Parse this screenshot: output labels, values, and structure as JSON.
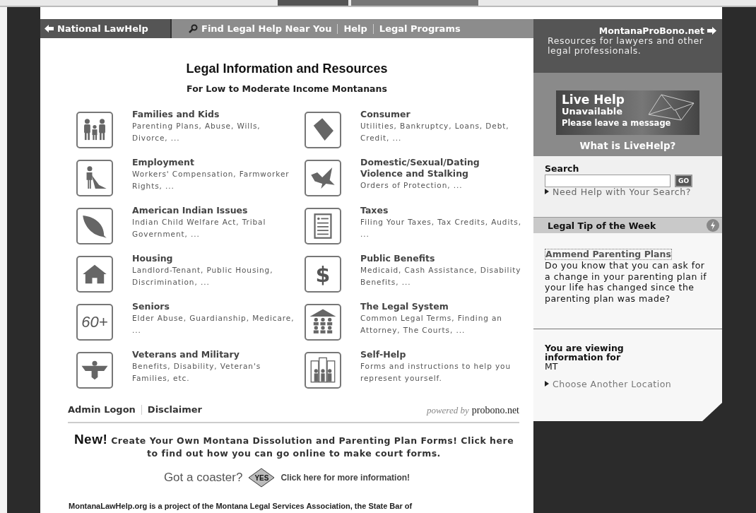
{
  "nav": {
    "home": {
      "label": "National LawHelp"
    },
    "links": [
      {
        "label": "Find Legal Help Near You",
        "kind": "search"
      },
      {
        "label": "Help",
        "kind": "plain"
      },
      {
        "label": "Legal Programs",
        "kind": "plain"
      }
    ]
  },
  "header": {
    "title": "Legal Information and Resources",
    "subtitle": "For Low to Moderate Income Montanans"
  },
  "categories": [
    {
      "title": "Families and Kids",
      "description": "Parenting Plans, Abuse, Wills, Divorce, ..."
    },
    {
      "title": "Consumer",
      "description": "Utilities, Bankruptcy, Loans, Debt, Credit, ..."
    },
    {
      "title": "Employment",
      "description": "Workers' Compensation, Farmworker Rights, ..."
    },
    {
      "title": "Domestic/Sexual/Dating Violence and Stalking",
      "description": "Orders of Protection, ..."
    },
    {
      "title": "American Indian Issues",
      "description": "Indian Child Welfare Act, Tribal Government, ..."
    },
    {
      "title": "Taxes",
      "description": "Filing Your Taxes, Tax Credits, Audits, ..."
    },
    {
      "title": "Housing",
      "description": "Landlord-Tenant, Public Housing, Discrimination, ..."
    },
    {
      "title": "Public Benefits",
      "description": "Medicaid, Cash Assistance, Disability Benefits, ...",
      "icon_text": "$"
    },
    {
      "title": "Seniors",
      "description": "Elder Abuse, Guardianship, Medicare, ...",
      "icon_text": "60+"
    },
    {
      "title": "The Legal System",
      "description": "Common Legal Terms, Finding an Attorney, The Courts, ..."
    },
    {
      "title": "Veterans and Military",
      "description": "Benefits, Disability, Veteran's Families, etc."
    },
    {
      "title": "Self-Help",
      "description": "Forms and instructions to help you represent yourself."
    }
  ],
  "footer_links": [
    "Admin Logon",
    "Disclaimer"
  ],
  "powered_by": {
    "prefix": "powered by",
    "brand": "probono.net"
  },
  "promo": {
    "lead": "New!",
    "text": "Create Your Own Montana Dissolution and Parenting Plan Forms! Click here to find out how you can go online to make court forms."
  },
  "coaster": {
    "question": "Got a coaster?",
    "badge": "YES",
    "link": "Click here for more information!"
  },
  "project_note": "MontanaLawHelp.org is a project of the Montana Legal Services Association, the State Bar of",
  "sidebar": {
    "probono": {
      "title": "MontanaProBono.net",
      "description": "Resources for lawyers and other legal professionals."
    },
    "livehelp": {
      "title": "Live Help",
      "status": "Unavailable",
      "message": "Please leave a message",
      "link": "What is LiveHelp?"
    },
    "search": {
      "label": "Search",
      "button": "GO",
      "help_link": "Need Help with Your Search?"
    },
    "tip": {
      "heading": "Legal Tip of the Week",
      "title": "Ammend Parenting Plans",
      "text": "Do you know that you can ask for a change in your parenting plan if your life has changed since the parenting plan was made?"
    },
    "location": {
      "label": "You are viewing information for",
      "value": "MT",
      "link": "Choose Another Location"
    }
  }
}
